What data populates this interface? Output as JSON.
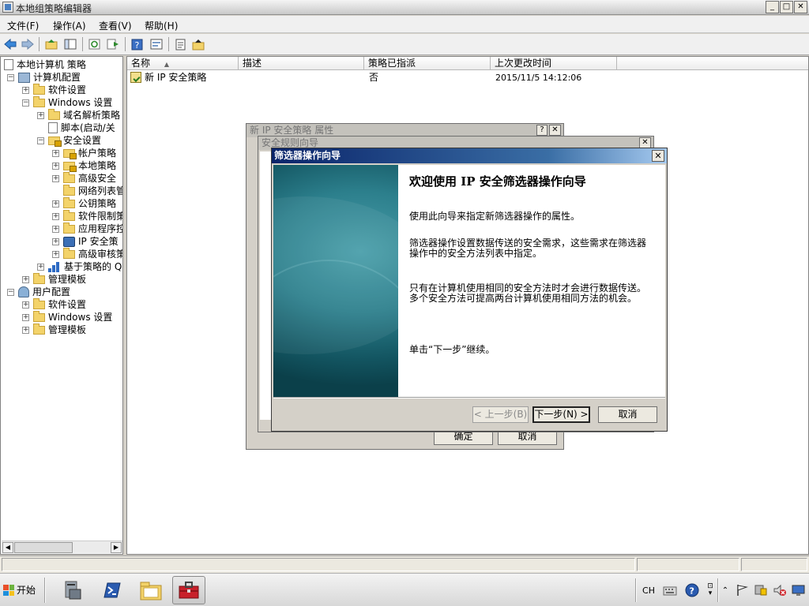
{
  "window": {
    "title": "本地组策略编辑器",
    "caption_buttons": [
      "_",
      "□",
      "✕"
    ]
  },
  "menu": [
    "文件(F)",
    "操作(A)",
    "查看(V)",
    "帮助(H)"
  ],
  "toolbar_icons": [
    "back-icon",
    "forward-icon",
    "up-folder-icon",
    "show-hide-tree-icon",
    "refresh-icon",
    "export-list-icon",
    "help-icon",
    "properties-icon",
    "new-icon",
    "import-icon"
  ],
  "tree": {
    "root": "本地计算机 策略",
    "computer_config": "计算机配置",
    "software_settings": "软件设置",
    "windows_settings": "Windows 设置",
    "name_resolution": "域名解析策略",
    "scripts": "脚本(启动/关",
    "security_settings": "安全设置",
    "account_policies": "帐户策略",
    "local_policies": "本地策略",
    "advanced_security": "高级安全",
    "network_list": "网络列表管",
    "public_key": "公钥策略",
    "software_restriction": "软件限制策",
    "app_control": "应用程序控",
    "ip_security": "IP 安全策",
    "advanced_audit": "高级审核策",
    "qos": "基于策略的 Q",
    "admin_templates": "管理模板",
    "user_config": "用户配置",
    "user_software": "软件设置",
    "user_windows": "Windows 设置",
    "user_admin": "管理模板"
  },
  "list": {
    "columns": [
      "名称",
      "描述",
      "策略已指派",
      "上次更改时间"
    ],
    "rows": [
      {
        "name": "新 IP 安全策略",
        "description": "",
        "assigned": "否",
        "modified": "2015/11/5 14:12:06"
      }
    ]
  },
  "dialog_props": {
    "title": "新 IP 安全策略 属性",
    "ok": "确定",
    "cancel": "取消"
  },
  "dialog_rule": {
    "title": "安全规则向导"
  },
  "wizard": {
    "title": "筛选器操作向导",
    "heading": "欢迎使用 IP 安全筛选器操作向导",
    "p1": "使用此向导来指定新筛选器操作的属性。",
    "p2": "筛选器操作设置数据传送的安全需求，这些需求在筛选器操作中的安全方法列表中指定。",
    "p3": "只有在计算机使用相同的安全方法时才会进行数据传送。多个安全方法可提高两台计算机使用相同方法的机会。",
    "p4": "单击“下一步”继续。",
    "back": "< 上一步(B)",
    "next": "下一步(N) >",
    "cancel": "取消"
  },
  "taskbar": {
    "start": "开始",
    "lang": "CH"
  },
  "colors": {
    "wizard_title": "#0a246a",
    "wizard_art": "#2c7f8c"
  }
}
